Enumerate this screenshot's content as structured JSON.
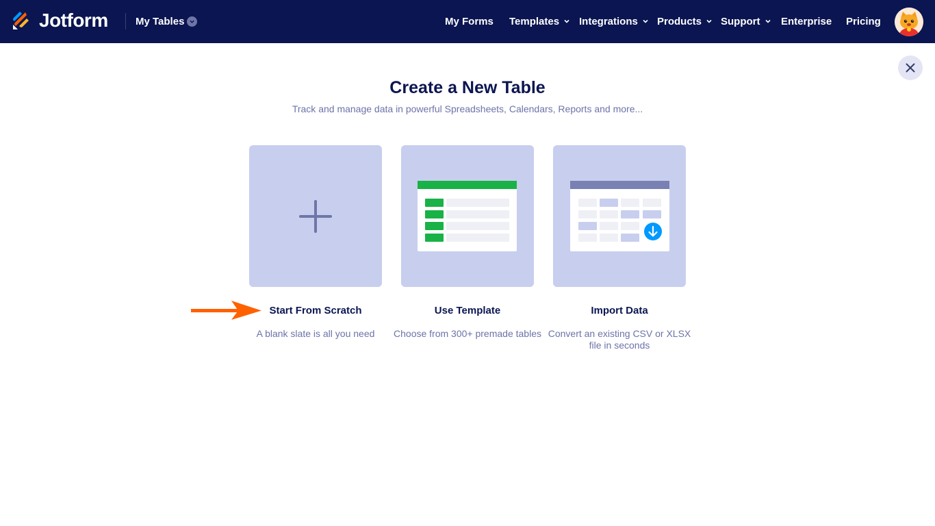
{
  "header": {
    "brand": "Jotform",
    "section": "My Tables",
    "nav": [
      {
        "label": "My Forms",
        "has_dropdown": false
      },
      {
        "label": "Templates",
        "has_dropdown": true
      },
      {
        "label": "Integrations",
        "has_dropdown": true
      },
      {
        "label": "Products",
        "has_dropdown": true
      },
      {
        "label": "Support",
        "has_dropdown": true
      },
      {
        "label": "Enterprise",
        "has_dropdown": false
      },
      {
        "label": "Pricing",
        "has_dropdown": false
      }
    ]
  },
  "main": {
    "title": "Create a New Table",
    "subtitle": "Track and manage data in powerful Spreadsheets, Calendars, Reports and more...",
    "options": [
      {
        "label": "Start From Scratch",
        "description": "A blank slate is all you need",
        "icon": "plus-icon"
      },
      {
        "label": "Use Template",
        "description": "Choose from 300+ premade tables",
        "icon": "spreadsheet-template-icon"
      },
      {
        "label": "Import Data",
        "description": "Convert an existing CSV or XLSX file in seconds",
        "icon": "import-table-icon"
      }
    ]
  },
  "colors": {
    "header_bg": "#0a1551",
    "card_bg": "#c8ceee",
    "accent_green": "#18b246",
    "accent_blue": "#0099ff",
    "arrow_orange": "#ff6100"
  }
}
